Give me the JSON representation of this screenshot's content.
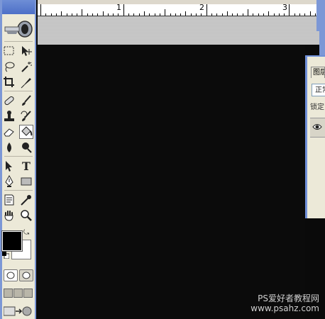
{
  "ruler": {
    "marks": [
      "1",
      "2",
      "3"
    ]
  },
  "tools": {
    "rect_marquee": "rect-marquee-icon",
    "move": "move-icon",
    "lasso": "lasso-icon",
    "magic_wand": "magic-wand-icon",
    "crop": "crop-icon",
    "slice": "slice-icon",
    "healing": "healing-brush-icon",
    "brush": "brush-icon",
    "stamp": "clone-stamp-icon",
    "history_brush": "history-brush-icon",
    "eraser": "eraser-icon",
    "paint_bucket": "paint-bucket-icon",
    "blur": "blur-icon",
    "dodge": "dodge-icon",
    "path_select": "path-select-icon",
    "type": "T",
    "pen": "pen-icon",
    "shape": "rectangle-shape-icon",
    "notes": "notes-icon",
    "eyedropper": "eyedropper-icon",
    "hand": "hand-icon",
    "zoom": "zoom-icon"
  },
  "colors": {
    "foreground": "#000000",
    "background": "#ffffff"
  },
  "layers_panel": {
    "tab_label": "图层",
    "blend_mode": "正常",
    "lock_label": "锁定"
  },
  "watermark": {
    "line1": "PS爱好者教程网",
    "line2": "www.psahz.com"
  }
}
